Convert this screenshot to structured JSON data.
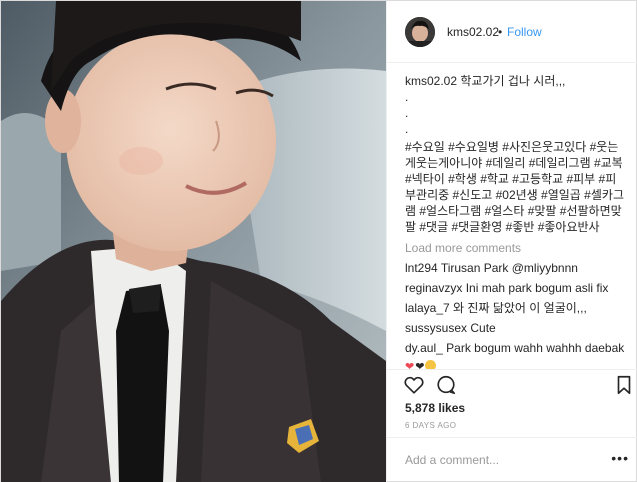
{
  "post": {
    "username": "kms02.02",
    "follow_label": "Follow",
    "separator": "•",
    "caption": {
      "username": "kms02.02",
      "text": "학교가기 겁나 시러,,,",
      "dots": [
        ".",
        ".",
        "."
      ],
      "hashtags": "#수요일 #수요일병 #사진은웃고있다 #웃는게웃는게아니야 #데일리 #데일리그램 #교복 #넥타이 #학생 #학교 #고등학교 #피부 #피부관리중 #신도고 #02년생 #열일곱 #셀카그램 #얼스타그램 #얼스타 #맞팔 #선팔하면맞팔 #댓글 #댓글환영 #좋반 #좋아요반사"
    },
    "load_more_label": "Load more comments",
    "comments": [
      {
        "user": "lnt294",
        "text": "Tirusan Park @mliyybnnn"
      },
      {
        "user": "reginavzyx",
        "text": "Ini mah park bogum asli fix"
      },
      {
        "user": "lalaya_7",
        "text": "와 진짜 닮았어 이 얼굴이,,,"
      },
      {
        "user": "sussysusex",
        "text": "Cute"
      },
      {
        "user": "dy.aul_",
        "text": "Park bogum wahh wahhh daebak"
      }
    ],
    "emoji_reply": [
      "❤",
      "❤",
      "face"
    ],
    "icons": {
      "like": "heart-icon",
      "comment": "comment-bubble-icon",
      "save": "bookmark-icon",
      "more": "more-options-icon"
    },
    "likes_label": "5,878 likes",
    "timestamp": "6 DAYS AGO",
    "add_comment_placeholder": "Add a comment...",
    "more_label": "•••"
  }
}
